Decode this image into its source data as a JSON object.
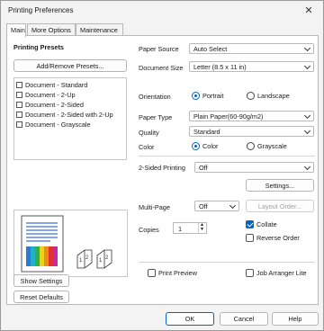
{
  "window": {
    "title": "Printing Preferences"
  },
  "tabs": [
    {
      "label": "Main",
      "active": true
    },
    {
      "label": "More Options",
      "active": false
    },
    {
      "label": "Maintenance",
      "active": false
    }
  ],
  "presets": {
    "heading": "Printing Presets",
    "add_remove_button": "Add/Remove Presets...",
    "items": [
      "Document - Standard",
      "Document - 2-Up",
      "Document - 2-Sided",
      "Document - 2-Sided with 2-Up",
      "Document - Grayscale"
    ],
    "show_settings_button": "Show Settings",
    "reset_defaults_button": "Reset Defaults"
  },
  "settings": {
    "paper_source": {
      "label": "Paper Source",
      "value": "Auto Select"
    },
    "document_size": {
      "label": "Document Size",
      "value": "Letter (8.5 x 11 in)"
    },
    "orientation": {
      "label": "Orientation",
      "options": [
        "Portrait",
        "Landscape"
      ],
      "selected": "Portrait"
    },
    "paper_type": {
      "label": "Paper Type",
      "value": "Plain Paper(60-90g/m2)"
    },
    "quality": {
      "label": "Quality",
      "value": "Standard"
    },
    "color": {
      "label": "Color",
      "options": [
        "Color",
        "Grayscale"
      ],
      "selected": "Color"
    },
    "two_sided": {
      "label": "2-Sided Printing",
      "value": "Off",
      "settings_button": "Settings..."
    },
    "multi_page": {
      "label": "Multi-Page",
      "value": "Off",
      "layout_button": "Layout Order..."
    },
    "copies": {
      "label": "Copies",
      "value": "1"
    },
    "collate": {
      "label": "Collate",
      "checked": true
    },
    "reverse_order": {
      "label": "Reverse Order",
      "checked": false
    },
    "print_preview": {
      "label": "Print Preview",
      "checked": false
    },
    "job_arranger": {
      "label": "Job Arranger Lite",
      "checked": false
    }
  },
  "footer": {
    "ok": "OK",
    "cancel": "Cancel",
    "help": "Help"
  },
  "colors": {
    "accent": "#0067c0"
  }
}
